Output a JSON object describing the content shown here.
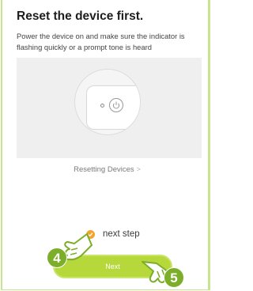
{
  "header": {
    "title": "Reset the device first.",
    "description": "Power the device on and make sure the indicator is flashing quickly or a prompt tone is heard"
  },
  "illustration": {
    "icon": "power-icon"
  },
  "resetting_link": {
    "label": "Resetting Devices",
    "chevron": ">"
  },
  "confirm": {
    "label": "next step",
    "checked": true,
    "icon": "check-icon"
  },
  "next_button": {
    "label": "Next"
  },
  "annotations": {
    "step_a": "4",
    "step_b": "5",
    "hand_icon": "pointing-hand-icon"
  },
  "colors": {
    "accent": "#b7d83a",
    "check": "#f3a52b",
    "badge": "#7cae2a",
    "frame": "#c7e48f"
  }
}
